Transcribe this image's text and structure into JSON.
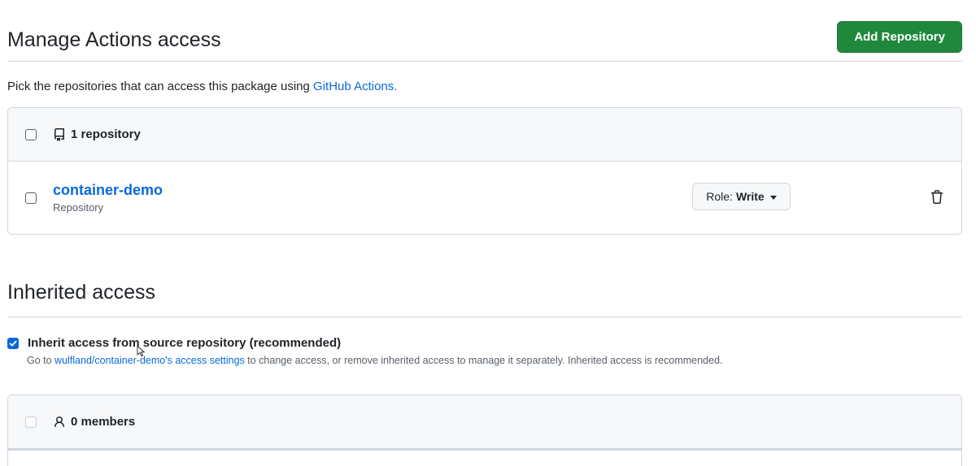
{
  "manage": {
    "title": "Manage Actions access",
    "add_button": "Add Repository",
    "description_prefix": "Pick the repositories that can access this package using ",
    "description_link": "GitHub Actions.",
    "list_header": "1 repository",
    "repos": [
      {
        "name": "container-demo",
        "type": "Repository",
        "role_label": "Role:",
        "role_value": "Write"
      }
    ]
  },
  "inherited": {
    "title": "Inherited access",
    "checkbox_label": "Inherit access from source repository (recommended)",
    "checked": true,
    "note_prefix": "Go to ",
    "note_link": "wulfland/container-demo's access settings",
    "note_suffix": " to change access, or remove inherited access to manage it separately. Inherited access is recommended.",
    "members_header": "0 members"
  },
  "colors": {
    "primary": "#1f883d",
    "link": "#0969da",
    "checkbox_checked": "#0969da"
  },
  "icons": [
    "repo-icon",
    "trash-icon",
    "person-icon",
    "check-icon",
    "caret-down-icon"
  ]
}
